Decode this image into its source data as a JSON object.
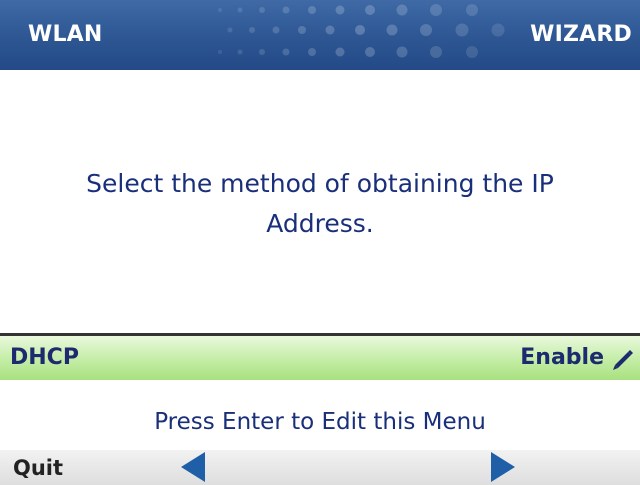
{
  "header": {
    "left_title": "WLAN",
    "right_title": "WIZARD"
  },
  "message": "Select the method of obtaining the IP Address.",
  "setting": {
    "label": "DHCP",
    "value": "Enable",
    "icon": "pencil-icon"
  },
  "hint": "Press Enter to Edit this Menu",
  "softkeys": {
    "quit_label": "Quit",
    "left_icon": "arrow-left-icon",
    "right_icon": "arrow-right-icon"
  },
  "colors": {
    "header_blue": "#2d5693",
    "text_navy": "#1a2f7a",
    "row_green": "#c3eda5",
    "arrow_blue": "#1f5fa8"
  }
}
